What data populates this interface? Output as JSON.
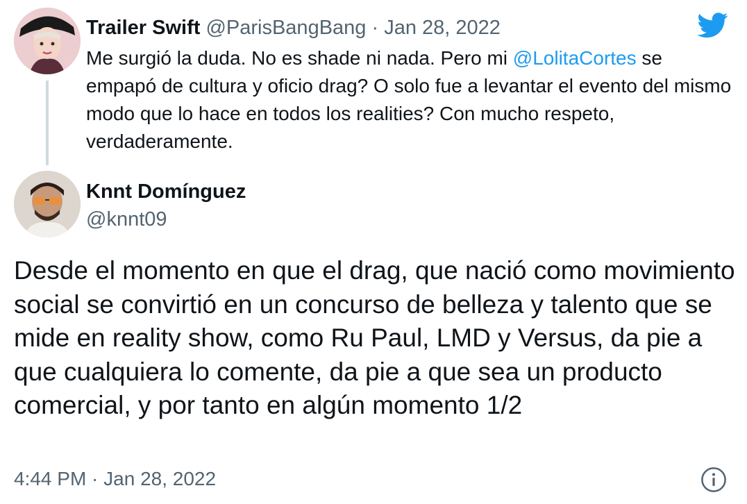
{
  "parent_tweet": {
    "name": "Trailer Swift",
    "meta": "@ParisBangBang · Jan 28, 2022",
    "text_before_mention": "Me surgió la duda. No es shade ni nada. Pero mi ",
    "mention": "@LolitaCortes",
    "text_after_mention": " se empapó de cultura y oficio drag? O solo fue a levantar el evento del mismo modo que lo hace en todos los realities? Con mucho respeto, verdaderamente."
  },
  "reply_tweet": {
    "name": "Knnt Domínguez",
    "handle": "@knnt09",
    "text": "Desde el momento en que el drag, que nació como movimiento social se convirtió en un concurso de belleza y talento que se mide en reality show, como Ru Paul, LMD y Versus, da pie a que cualquiera lo comente, da pie a que sea un producto comercial, y por tanto en algún momento 1/2",
    "timestamp": "4:44 PM · Jan 28, 2022"
  },
  "icons": {
    "logo": "twitter-bird-icon",
    "info": "info-icon"
  },
  "colors": {
    "accent": "#1d9bf0",
    "muted": "#536471",
    "thread_line": "#cfd9de"
  }
}
